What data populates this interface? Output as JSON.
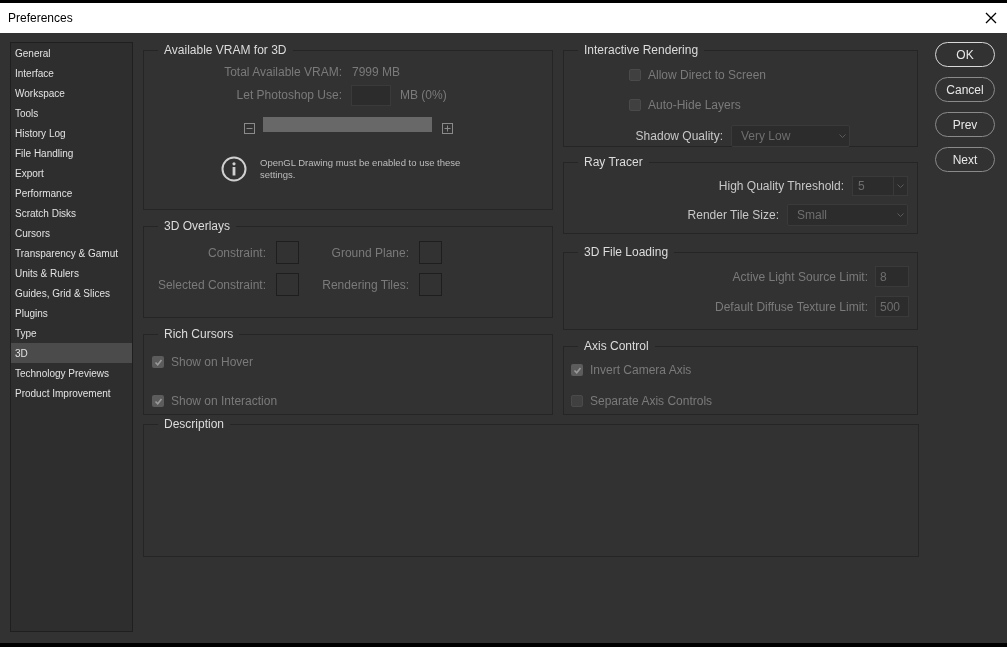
{
  "window": {
    "title": "Preferences"
  },
  "sidebar": {
    "items": [
      {
        "label": "General",
        "selected": false
      },
      {
        "label": "Interface",
        "selected": false
      },
      {
        "label": "Workspace",
        "selected": false
      },
      {
        "label": "Tools",
        "selected": false
      },
      {
        "label": "History Log",
        "selected": false
      },
      {
        "label": "File Handling",
        "selected": false
      },
      {
        "label": "Export",
        "selected": false
      },
      {
        "label": "Performance",
        "selected": false
      },
      {
        "label": "Scratch Disks",
        "selected": false
      },
      {
        "label": "Cursors",
        "selected": false
      },
      {
        "label": "Transparency & Gamut",
        "selected": false
      },
      {
        "label": "Units & Rulers",
        "selected": false
      },
      {
        "label": "Guides, Grid & Slices",
        "selected": false
      },
      {
        "label": "Plugins",
        "selected": false
      },
      {
        "label": "Type",
        "selected": false
      },
      {
        "label": "3D",
        "selected": true
      },
      {
        "label": "Technology Previews",
        "selected": false
      },
      {
        "label": "Product Improvement",
        "selected": false
      }
    ]
  },
  "vram": {
    "title": "Available VRAM for 3D",
    "total_label": "Total Available VRAM:",
    "total_value": "7999 MB",
    "use_label": "Let Photoshop Use:",
    "use_suffix": "MB (0%)",
    "note": "OpenGL Drawing must be enabled to use these settings."
  },
  "overlays": {
    "title": "3D Overlays",
    "items": [
      {
        "label": "Constraint:"
      },
      {
        "label": "Ground Plane:"
      },
      {
        "label": "Selected Constraint:"
      },
      {
        "label": "Rendering Tiles:"
      }
    ]
  },
  "rich_cursors": {
    "title": "Rich Cursors",
    "options": [
      {
        "label": "Show on Hover",
        "checked": true
      },
      {
        "label": "Show on Interaction",
        "checked": true
      }
    ]
  },
  "interactive_rendering": {
    "title": "Interactive Rendering",
    "options": [
      {
        "label": "Allow Direct to Screen",
        "checked": false
      },
      {
        "label": "Auto-Hide Layers",
        "checked": false
      }
    ],
    "shadow_quality": {
      "label": "Shadow Quality:",
      "value": "Very Low"
    }
  },
  "ray_tracer": {
    "title": "Ray Tracer",
    "threshold": {
      "label": "High Quality Threshold:",
      "value": "5"
    },
    "tile_size": {
      "label": "Render Tile Size:",
      "value": "Small"
    }
  },
  "file_loading": {
    "title": "3D File Loading",
    "fields": [
      {
        "label": "Active Light Source Limit:",
        "value": "8"
      },
      {
        "label": "Default Diffuse Texture Limit:",
        "value": "500"
      }
    ]
  },
  "axis_control": {
    "title": "Axis Control",
    "options": [
      {
        "label": "Invert Camera Axis",
        "checked": true
      },
      {
        "label": "Separate Axis Controls",
        "checked": false
      }
    ]
  },
  "description": {
    "title": "Description"
  },
  "buttons": [
    {
      "label": "OK",
      "default": true
    },
    {
      "label": "Cancel",
      "default": false
    },
    {
      "label": "Prev",
      "default": false
    },
    {
      "label": "Next",
      "default": false
    }
  ]
}
